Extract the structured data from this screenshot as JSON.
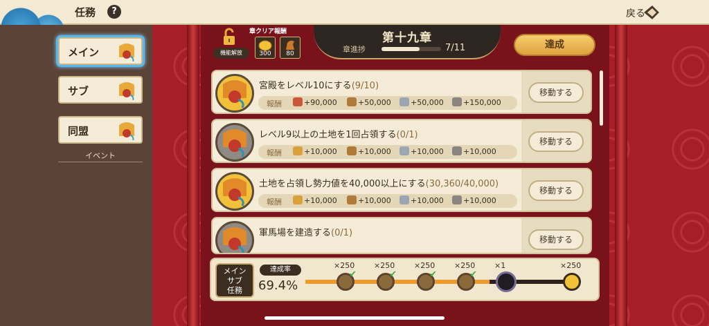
{
  "header": {
    "title": "任務",
    "help": "?",
    "back_label": "戻る"
  },
  "sidebar": {
    "tabs": [
      {
        "label": "メイン",
        "active": true
      },
      {
        "label": "サブ",
        "active": false
      },
      {
        "label": "同盟",
        "active": false
      }
    ],
    "event_label": "イベント"
  },
  "chapter_reward": {
    "unlock_label": "機能解放",
    "title": "章クリア報酬",
    "items": [
      {
        "icon": "gold-coin-icon",
        "count": "300"
      },
      {
        "icon": "horse-icon",
        "count": "80"
      }
    ]
  },
  "chapter": {
    "name": "第十九章",
    "progress_label": "章進捗",
    "progress_text": "7/11",
    "progress_fraction": 0.636
  },
  "achieve_button": "達成",
  "quests": [
    {
      "title": "宮殿をレベル10にする",
      "progress": "(9/10)",
      "icon_style": "gold",
      "reward_label": "報酬",
      "rewards": [
        {
          "icon": "meat-icon",
          "amount": "+90,000"
        },
        {
          "icon": "wood-icon",
          "amount": "+50,000"
        },
        {
          "icon": "iron-icon",
          "amount": "+50,000"
        },
        {
          "icon": "stone-icon",
          "amount": "+150,000"
        }
      ],
      "button": "移動する"
    },
    {
      "title": "レベル9以上の土地を1回占領する",
      "progress": "(0/1)",
      "icon_style": "gray",
      "reward_label": "報酬",
      "rewards": [
        {
          "icon": "grain-icon",
          "amount": "+10,000"
        },
        {
          "icon": "wood-icon",
          "amount": "+10,000"
        },
        {
          "icon": "iron-icon",
          "amount": "+10,000"
        },
        {
          "icon": "stone-icon",
          "amount": "+10,000"
        }
      ],
      "button": "移動する"
    },
    {
      "title": "土地を占領し勢力値を40,000以上にする",
      "progress": "(30,360/40,000)",
      "icon_style": "gold",
      "reward_label": "報酬",
      "rewards": [
        {
          "icon": "grain-icon",
          "amount": "+10,000"
        },
        {
          "icon": "wood-icon",
          "amount": "+10,000"
        },
        {
          "icon": "iron-icon",
          "amount": "+10,000"
        },
        {
          "icon": "stone-icon",
          "amount": "+10,000"
        }
      ],
      "button": "移動する"
    },
    {
      "title": "軍馬場を建造する",
      "progress": "(0/1)",
      "icon_style": "gray",
      "reward_label": "",
      "rewards": [],
      "button": "移動する"
    }
  ],
  "bottom": {
    "badge_line1": "メイン",
    "badge_line2": "サブ",
    "badge_line3": "任務",
    "rate_label": "達成率",
    "rate": "69.4%",
    "rate_fraction": 0.694,
    "milestones": [
      {
        "mult": "×250",
        "claimed": true
      },
      {
        "mult": "×250",
        "claimed": true
      },
      {
        "mult": "×250",
        "claimed": true
      },
      {
        "mult": "×250",
        "claimed": true
      },
      {
        "mult": "×1",
        "claimed": false
      },
      {
        "mult": "×250",
        "claimed": false
      }
    ]
  },
  "colors": {
    "accent_red": "#a51e28",
    "progress_orange": "#f19a26",
    "panel_cream": "#f4ecd6"
  }
}
